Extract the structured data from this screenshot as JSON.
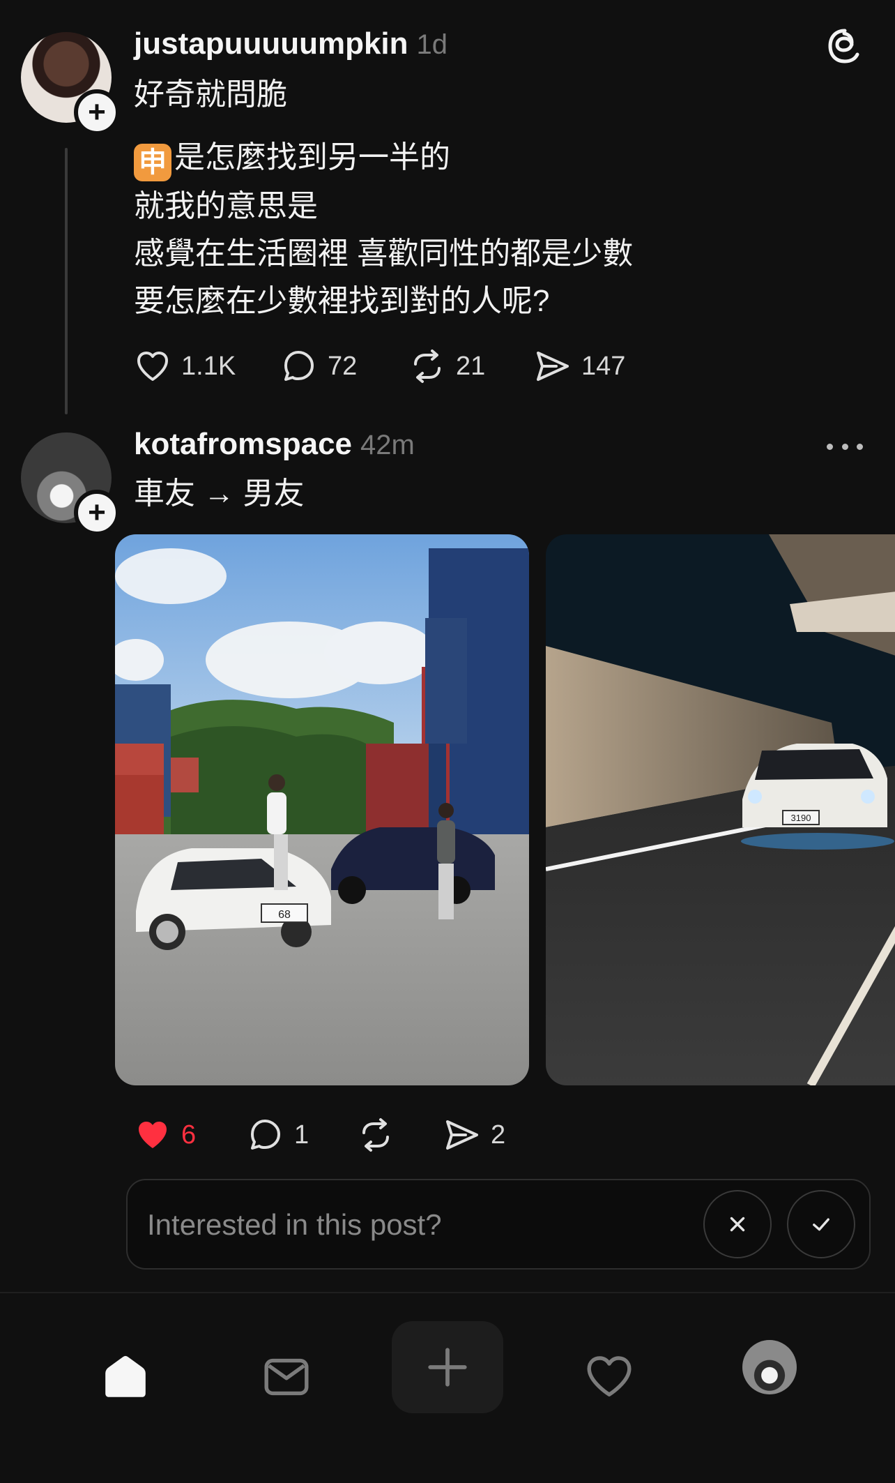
{
  "post1": {
    "username": "justapuuuuumpkin",
    "time": "1d",
    "lines": [
      "好奇就問脆",
      "是怎麼找到另一半的",
      "就我的意思是",
      "感覺在生活圈裡 喜歡同性的都是少數",
      "要怎麼在少數裡找到對的人呢?"
    ],
    "emoji": "申",
    "likes": "1.1K",
    "comments": "72",
    "reposts": "21",
    "shares": "147"
  },
  "post2": {
    "username": "kotafromspace",
    "time": "42m",
    "text": "車友 → 男友",
    "likes": "6",
    "comments": "1",
    "shares": "2",
    "plate1": "68",
    "plate2": "3190"
  },
  "interest": {
    "placeholder": "Interested in this post?"
  },
  "colors": {
    "background": "#101010",
    "liked": "#ff3040",
    "text": "#f3f3f3",
    "muted": "#7a7a7a"
  },
  "icons": {
    "threads": "threads-logo-icon",
    "more": "more-horizontal-icon",
    "home": "home-icon",
    "inbox": "inbox-icon",
    "create": "plus-icon",
    "activity": "heart-icon",
    "profile": "avatar"
  }
}
